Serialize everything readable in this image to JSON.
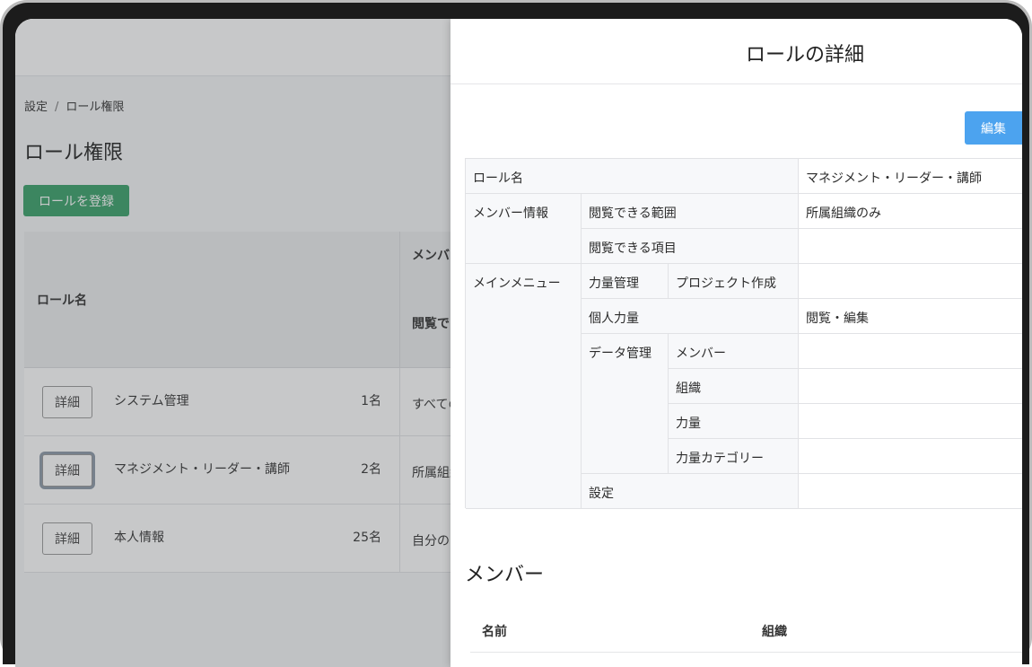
{
  "breadcrumb": {
    "root": "設定",
    "separator": "/",
    "current": "ロール権限"
  },
  "page": {
    "title": "ロール権限",
    "register_label": "ロールを登録"
  },
  "roles_table": {
    "headers": {
      "role_name": "ロール名",
      "member_group": "メンバー",
      "view": "閲覧で"
    },
    "detail_label": "詳細",
    "rows": [
      {
        "name": "システム管理",
        "count": "1名",
        "scope": "すべての"
      },
      {
        "name": "マネジメント・リーダー・講師",
        "count": "2名",
        "scope": "所属組織"
      },
      {
        "name": "本人情報",
        "count": "25名",
        "scope": "自分の"
      }
    ]
  },
  "drawer": {
    "title": "ロールの詳細",
    "edit_label": "編集",
    "permissions": {
      "role_name_label": "ロール名",
      "role_name_value": "マネジメント・リーダー・講師",
      "member_info_label": "メンバー情報",
      "view_range_label": "閲覧できる範囲",
      "view_range_value": "所属組織のみ",
      "view_items_label": "閲覧できる項目",
      "view_items_value": "",
      "main_menu_label": "メインメニュー",
      "skill_mgmt_label": "力量管理",
      "project_create_label": "プロジェクト作成",
      "project_create_value": "",
      "personal_skill_label": "個人力量",
      "personal_skill_value": "閲覧・編集",
      "data_mgmt_label": "データ管理",
      "member_label": "メンバー",
      "member_value": "",
      "org_label": "組織",
      "org_value": "",
      "skill_label": "力量",
      "skill_value": "",
      "skill_category_label": "力量カテゴリー",
      "skill_category_value": "",
      "settings_label": "設定",
      "settings_value": ""
    },
    "members": {
      "title": "メンバー",
      "columns": [
        "名前",
        "組織"
      ]
    }
  }
}
